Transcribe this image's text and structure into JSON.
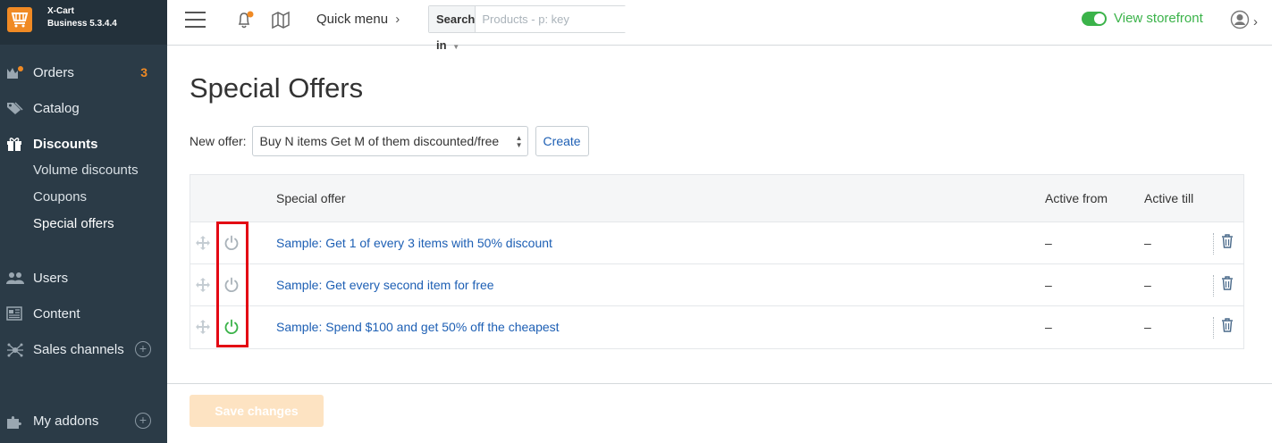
{
  "brand": {
    "line1": "X-Cart",
    "line2": "Business 5.3.4.4"
  },
  "sidebar": {
    "items": [
      {
        "label": "Orders",
        "badge": "3",
        "icon": "orders-icon"
      },
      {
        "label": "Catalog",
        "icon": "tag-icon"
      },
      {
        "label": "Discounts",
        "icon": "gift-icon",
        "active": true,
        "children": [
          "Volume discounts",
          "Coupons",
          "Special offers"
        ]
      },
      {
        "label": "Users",
        "icon": "users-icon"
      },
      {
        "label": "Content",
        "icon": "content-icon"
      },
      {
        "label": "Sales channels",
        "icon": "network-icon",
        "expandable": true
      },
      {
        "label": "My addons",
        "icon": "puzzle-icon",
        "expandable": true
      }
    ]
  },
  "topbar": {
    "quick_menu": "Quick menu",
    "search_in": "Search in",
    "search_placeholder": "Products - p: key",
    "storefront": "View storefront",
    "storefront_enabled": true
  },
  "page": {
    "title": "Special Offers",
    "new_offer_label": "New offer:",
    "new_offer_selected": "Buy N items Get M of them discounted/free",
    "create_label": "Create",
    "save_label": "Save changes"
  },
  "table": {
    "headers": {
      "offer": "Special offer",
      "from": "Active from",
      "till": "Active till"
    },
    "rows": [
      {
        "offer": "Sample: Get 1 of every 3 items with 50% discount",
        "from": "–",
        "till": "–",
        "enabled": false
      },
      {
        "offer": "Sample: Get every second item for free",
        "from": "–",
        "till": "–",
        "enabled": false
      },
      {
        "offer": "Sample: Spend $100 and get 50% off the cheapest",
        "from": "–",
        "till": "–",
        "enabled": true
      }
    ]
  },
  "colors": {
    "sidebar_bg": "#2b3b47",
    "accent_orange": "#f08a24",
    "link_blue": "#1d5fb4",
    "enabled_green": "#3bb34a",
    "disabled_gray": "#aab3ba",
    "highlight_red": "#e30613"
  }
}
